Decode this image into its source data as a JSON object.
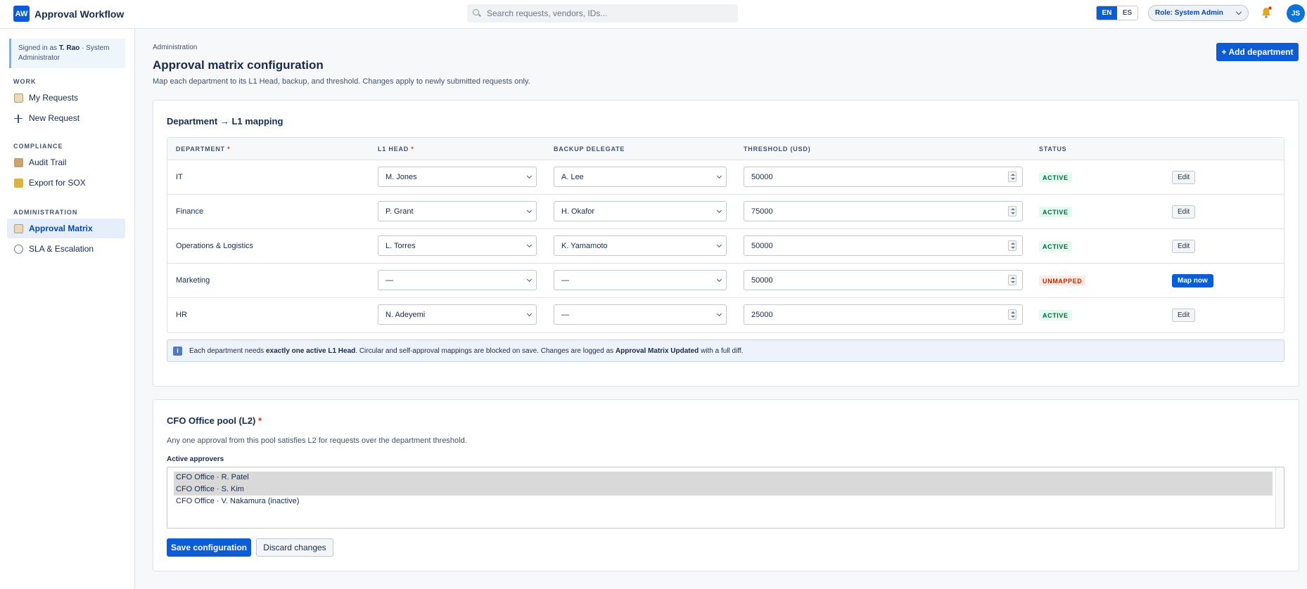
{
  "app": {
    "logo": "AW",
    "title": "Approval Workflow"
  },
  "search": {
    "placeholder": "Search requests, vendors, IDs..."
  },
  "lang": {
    "en": "EN",
    "es": "ES",
    "active": "EN"
  },
  "role": {
    "label": "Role:",
    "value": "System Admin"
  },
  "user": {
    "initials": "JS"
  },
  "sidebar": {
    "signed_prefix": "Signed in as",
    "signed_name": "T. Rao",
    "signed_suffix": "· System Administrator",
    "sections": [
      {
        "label": "WORK",
        "items": [
          {
            "label": "My Requests",
            "icon": "document-icon"
          },
          {
            "label": "New Request",
            "icon": "plus-icon"
          }
        ]
      },
      {
        "label": "COMPLIANCE",
        "items": [
          {
            "label": "Audit Trail",
            "icon": "archive-icon"
          },
          {
            "label": "Export for SOX",
            "icon": "lock-icon"
          }
        ]
      },
      {
        "label": "ADMINISTRATION",
        "items": [
          {
            "label": "Approval Matrix",
            "icon": "folder-icon",
            "active": true
          },
          {
            "label": "SLA & Escalation",
            "icon": "clock-icon"
          }
        ]
      }
    ]
  },
  "page": {
    "breadcrumb": "Administration",
    "title": "Approval matrix configuration",
    "subtitle": "Map each department to its L1 Head, backup, and threshold. Changes apply to newly submitted requests only.",
    "add_button": "+ Add department"
  },
  "mapping": {
    "title": "Department → L1 mapping",
    "headers": {
      "department": "DEPARTMENT",
      "l1": "L1 HEAD",
      "backup": "BACKUP DELEGATE",
      "threshold": "THRESHOLD (USD)",
      "status": "STATUS"
    },
    "rows": [
      {
        "department": "IT",
        "l1": "M. Jones",
        "backup": "A. Lee",
        "threshold": "50000",
        "status": "ACTIVE",
        "action": "Edit"
      },
      {
        "department": "Finance",
        "l1": "P. Grant",
        "backup": "H. Okafor",
        "threshold": "75000",
        "status": "ACTIVE",
        "action": "Edit"
      },
      {
        "department": "Operations & Logistics",
        "l1": "L. Torres",
        "backup": "K. Yamamoto",
        "threshold": "50000",
        "status": "ACTIVE",
        "action": "Edit"
      },
      {
        "department": "Marketing",
        "l1": "—",
        "backup": "—",
        "threshold": "50000",
        "status": "UNMAPPED",
        "action": "Map now"
      },
      {
        "department": "HR",
        "l1": "N. Adeyemi",
        "backup": "—",
        "threshold": "25000",
        "status": "ACTIVE",
        "action": "Edit"
      }
    ],
    "info": {
      "icon": "i",
      "t1": "Each department needs ",
      "b1": "exactly one active L1 Head",
      "t2": ". Circular and self-approval mappings are blocked on save. Changes are logged as ",
      "b2": "Approval Matrix Updated",
      "t3": " with a full diff."
    }
  },
  "pool": {
    "title": "CFO Office pool (L2)",
    "required_mark": "*",
    "subtitle": "Any one approval from this pool satisfies L2 for requests over the department threshold.",
    "label": "Active approvers",
    "options": [
      {
        "label": "CFO Office · R. Patel",
        "selected": true
      },
      {
        "label": "CFO Office · S. Kim",
        "selected": true
      },
      {
        "label": "CFO Office · V. Nakamura (inactive)",
        "selected": false
      }
    ],
    "save": "Save configuration",
    "discard": "Discard changes"
  },
  "colors": {
    "primary": "#0b5cd5",
    "active_badge_bg": "#e3fcef",
    "active_badge_fg": "#006644",
    "unmapped_bg": "#ffebe6",
    "unmapped_fg": "#bf2600"
  }
}
